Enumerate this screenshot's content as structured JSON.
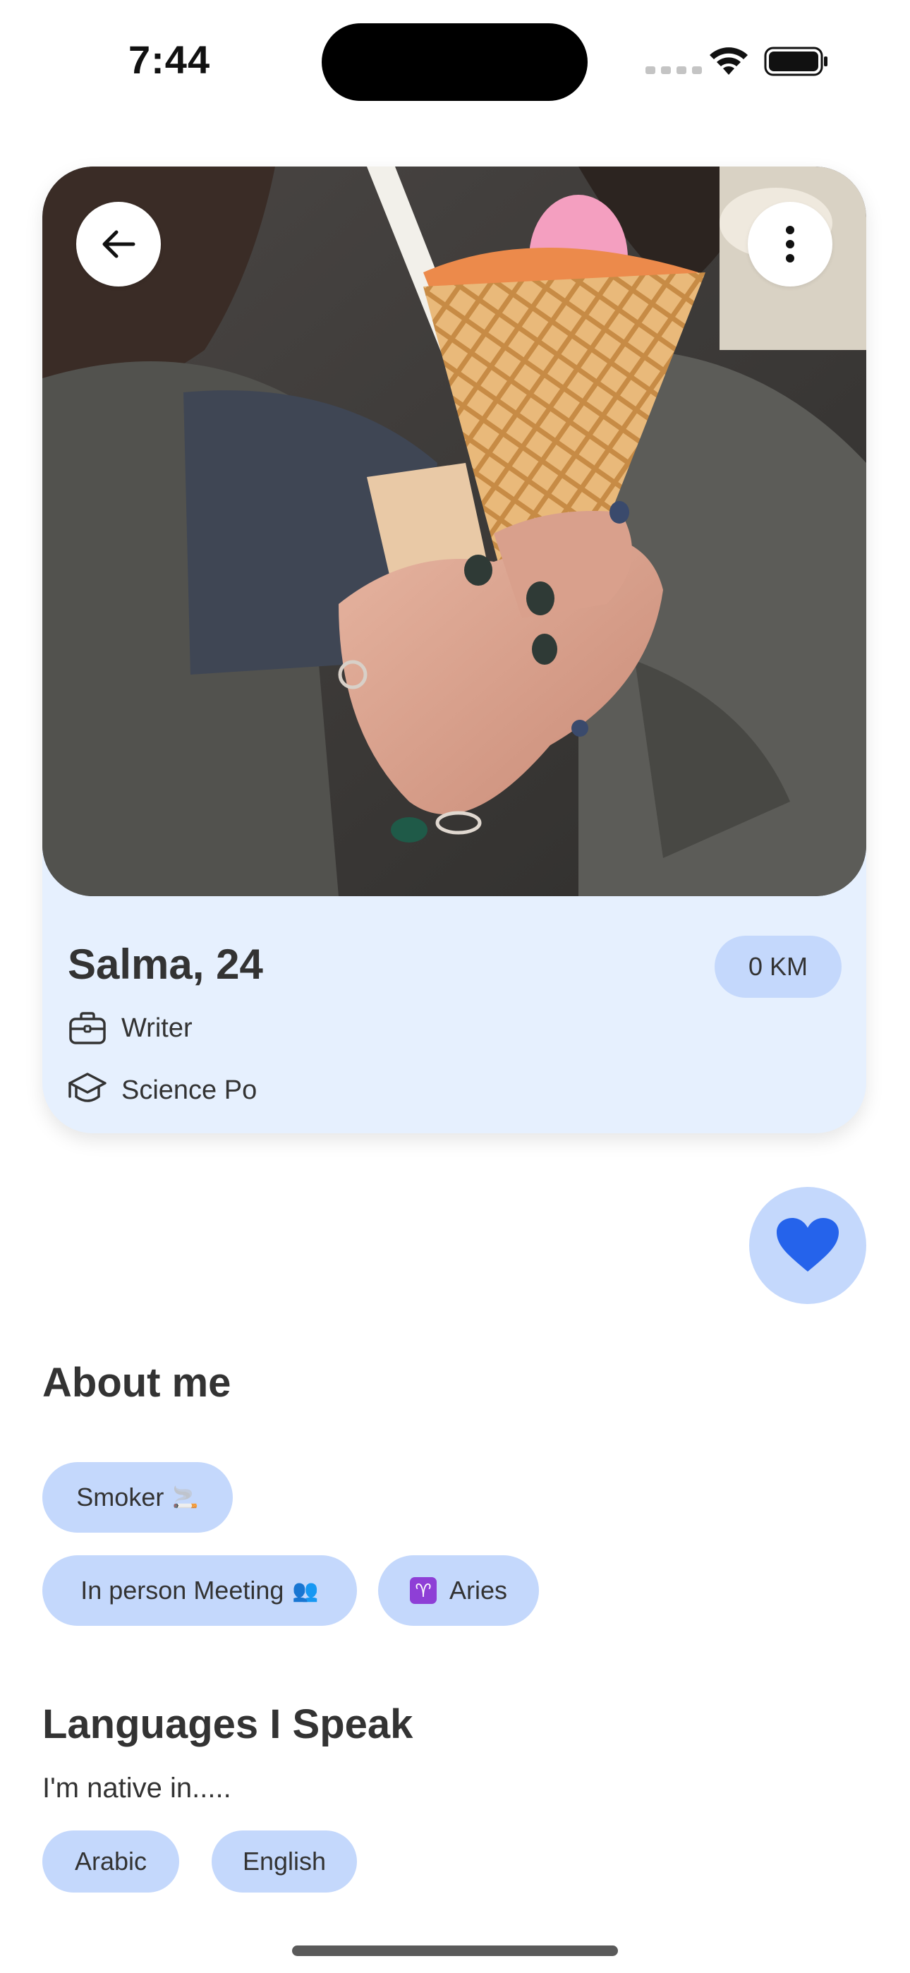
{
  "status_bar": {
    "time": "7:44"
  },
  "profile": {
    "name_age": "Salma, 24",
    "distance": "0 KM",
    "job": "Writer",
    "school": "Science Po",
    "photo_icon": "profile-photo"
  },
  "about": {
    "title": "About me",
    "chips": {
      "smoker": "Smoker",
      "smoker_emoji": "🚬",
      "meeting": "In person Meeting",
      "meeting_emoji": "👥",
      "aries_symbol": "♈",
      "aries": "Aries"
    }
  },
  "languages": {
    "title": "Languages I Speak",
    "subtitle": "I'm native in.....",
    "items": [
      "Arabic",
      "English"
    ]
  },
  "colors": {
    "accent": "#2563eb",
    "chip_bg": "#c4d8fc",
    "card_bg": "#e6f0fe"
  },
  "icons": {
    "back": "arrow-left-icon",
    "more": "more-vertical-icon",
    "job": "briefcase-icon",
    "school": "graduation-cap-icon",
    "like": "heart-icon"
  }
}
